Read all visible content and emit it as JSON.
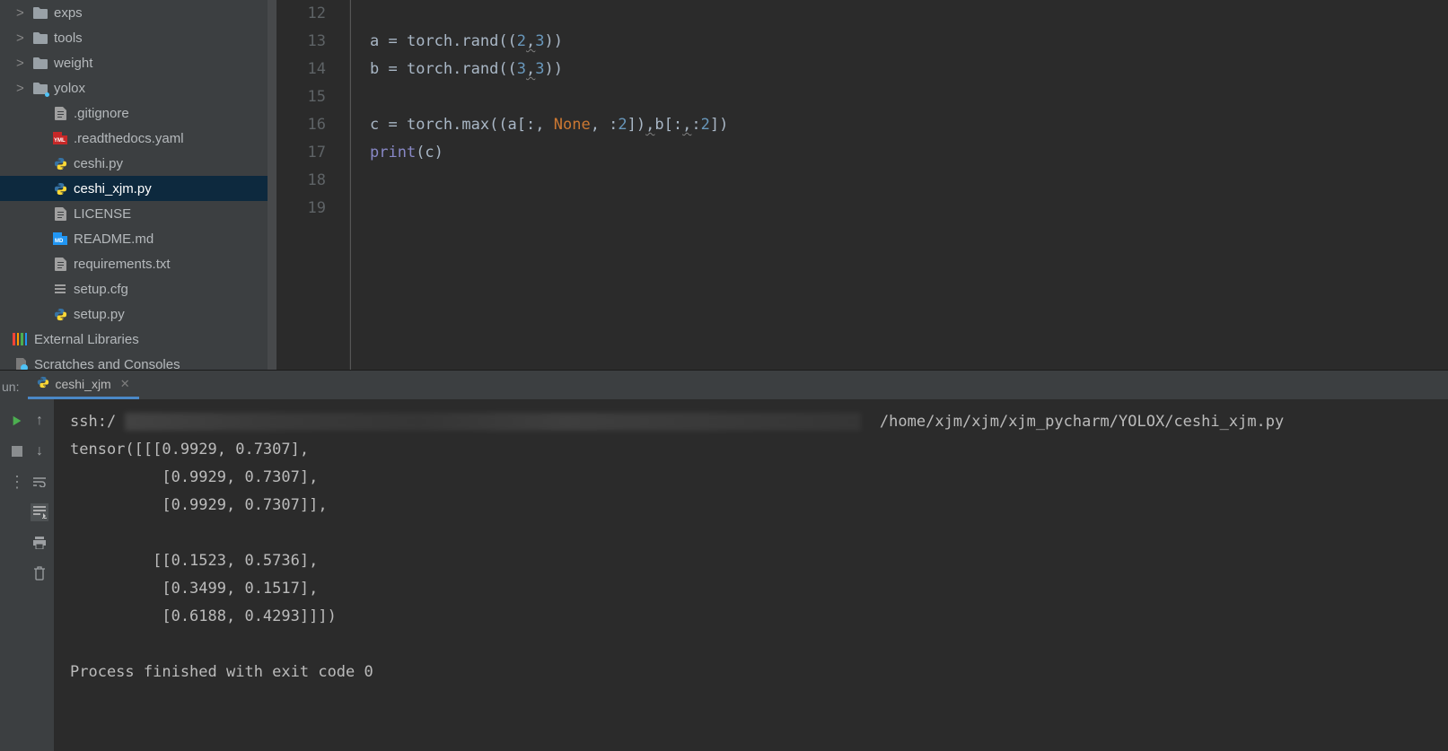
{
  "sidebar": {
    "items": [
      {
        "name": "exps",
        "type": "folder",
        "arrow": ">",
        "indent": 0
      },
      {
        "name": "tools",
        "type": "folder",
        "arrow": ">",
        "indent": 0
      },
      {
        "name": "weight",
        "type": "folder",
        "arrow": ">",
        "indent": 0
      },
      {
        "name": "yolox",
        "type": "folder-dot",
        "arrow": ">",
        "indent": 0
      },
      {
        "name": ".gitignore",
        "type": "file",
        "indent": 1
      },
      {
        "name": ".readthedocs.yaml",
        "type": "yaml",
        "indent": 1
      },
      {
        "name": "ceshi.py",
        "type": "python",
        "indent": 1
      },
      {
        "name": "ceshi_xjm.py",
        "type": "python",
        "indent": 1,
        "selected": true
      },
      {
        "name": "LICENSE",
        "type": "file",
        "indent": 1
      },
      {
        "name": "README.md",
        "type": "md",
        "indent": 1
      },
      {
        "name": "requirements.txt",
        "type": "file",
        "indent": 1
      },
      {
        "name": "setup.cfg",
        "type": "cfg",
        "indent": 1
      },
      {
        "name": "setup.py",
        "type": "python",
        "indent": 1
      }
    ],
    "external": "External Libraries",
    "scratches": "Scratches and Consoles"
  },
  "editor": {
    "lineNumbers": [
      "12",
      "13",
      "14",
      "15",
      "16",
      "17",
      "18",
      "19"
    ],
    "lines": [
      {
        "tokens": []
      },
      {
        "tokens": [
          {
            "t": "a ",
            "c": "c-default"
          },
          {
            "t": "= ",
            "c": "c-op"
          },
          {
            "t": "torch.rand((",
            "c": "c-default"
          },
          {
            "t": "2",
            "c": "c-num"
          },
          {
            "t": ",",
            "c": "c-op underline"
          },
          {
            "t": "3",
            "c": "c-num"
          },
          {
            "t": "))",
            "c": "c-default"
          }
        ]
      },
      {
        "tokens": [
          {
            "t": "b ",
            "c": "c-default"
          },
          {
            "t": "= ",
            "c": "c-op"
          },
          {
            "t": "torch.rand((",
            "c": "c-default"
          },
          {
            "t": "3",
            "c": "c-num"
          },
          {
            "t": ",",
            "c": "c-op underline"
          },
          {
            "t": "3",
            "c": "c-num"
          },
          {
            "t": "))",
            "c": "c-default"
          }
        ]
      },
      {
        "tokens": []
      },
      {
        "tokens": [
          {
            "t": "c ",
            "c": "c-default"
          },
          {
            "t": "= ",
            "c": "c-op"
          },
          {
            "t": "torch.max((a[:",
            "c": "c-default"
          },
          {
            "t": ", ",
            "c": "c-op"
          },
          {
            "t": "None",
            "c": "c-none"
          },
          {
            "t": ", :",
            "c": "c-op"
          },
          {
            "t": "2",
            "c": "c-num"
          },
          {
            "t": "])",
            "c": "c-default"
          },
          {
            "t": ",",
            "c": "c-op underline"
          },
          {
            "t": "b[:",
            "c": "c-default"
          },
          {
            "t": ",",
            "c": "c-op underline"
          },
          {
            "t": ":",
            "c": "c-op"
          },
          {
            "t": "2",
            "c": "c-num"
          },
          {
            "t": "])",
            "c": "c-default"
          }
        ]
      },
      {
        "tokens": [
          {
            "t": "print",
            "c": "c-builtin"
          },
          {
            "t": "(c)",
            "c": "c-default"
          }
        ]
      },
      {
        "tokens": []
      },
      {
        "tokens": []
      }
    ]
  },
  "run": {
    "label": "un:",
    "tab": "ceshi_xjm",
    "sshPrefix": "ssh:/",
    "path": " /home/xjm/xjm/xjm_pycharm/YOLOX/ceshi_xjm.py",
    "output": "tensor([[[0.9929, 0.7307],\n          [0.9929, 0.7307],\n          [0.9929, 0.7307]],\n\n         [[0.1523, 0.5736],\n          [0.3499, 0.1517],\n          [0.6188, 0.4293]]])\n\nProcess finished with exit code 0"
  }
}
